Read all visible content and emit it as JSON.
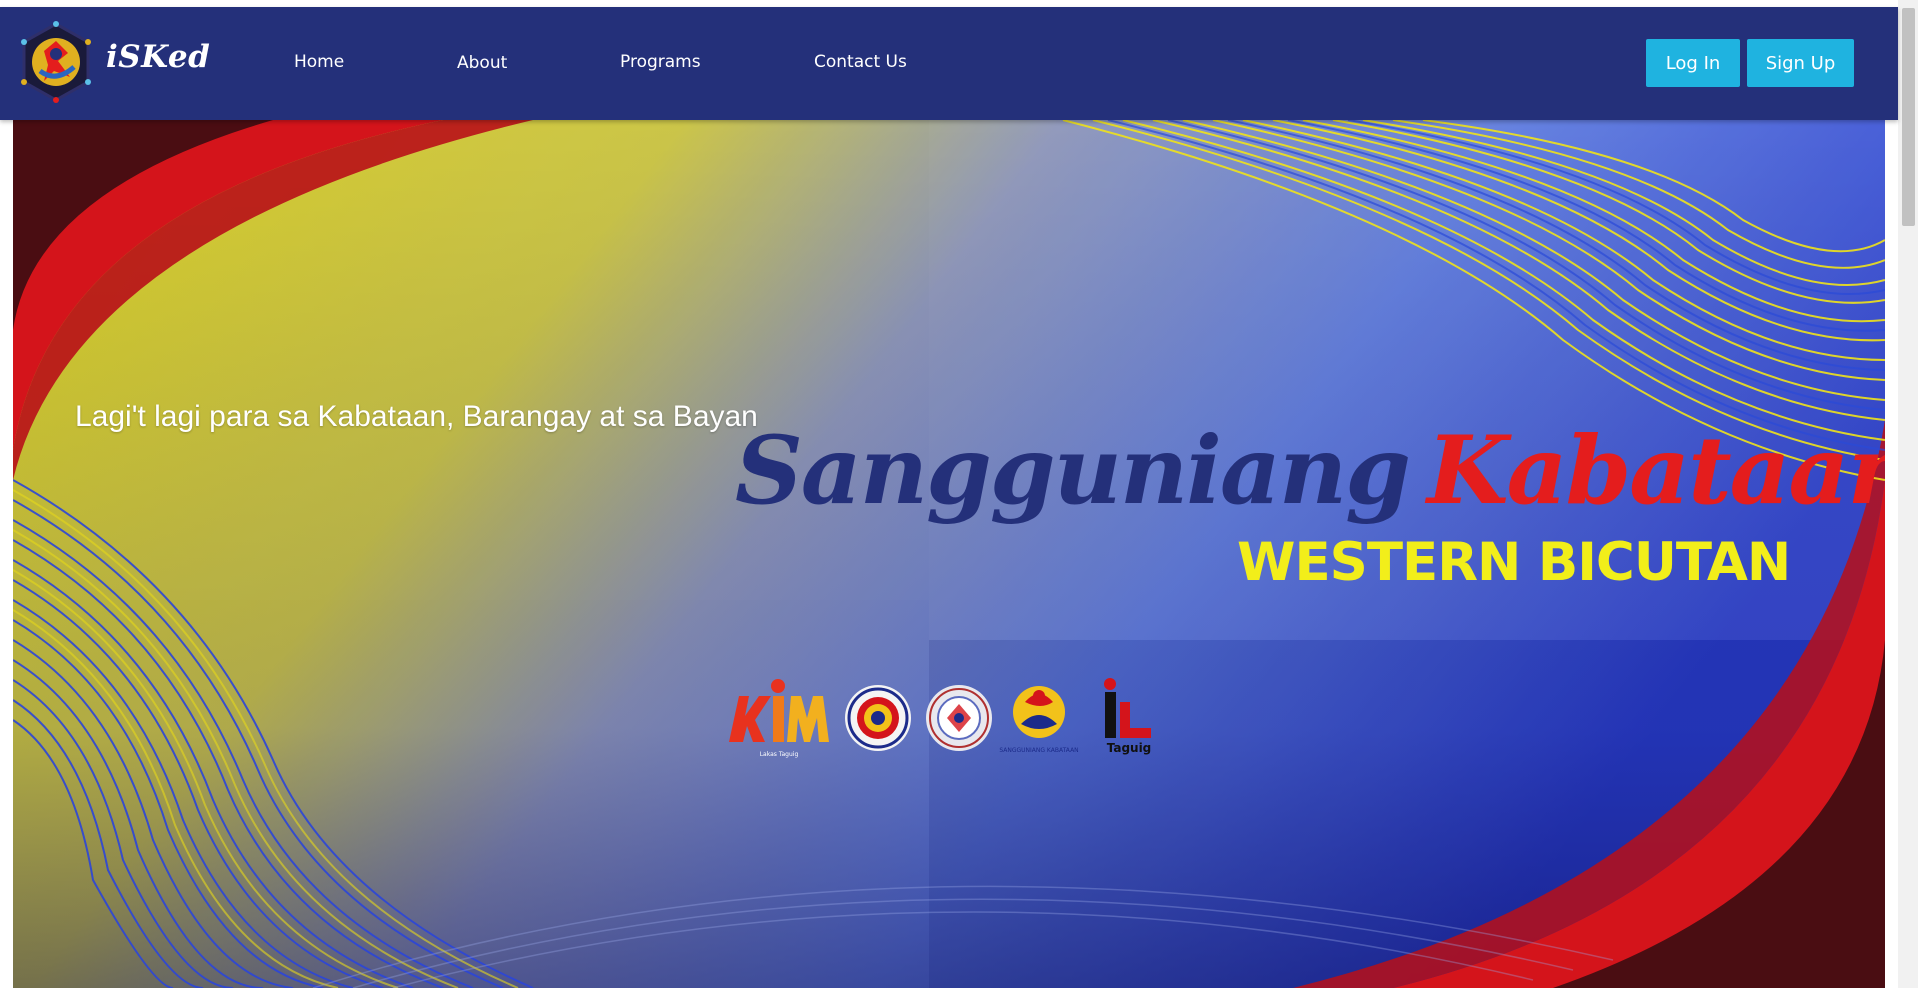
{
  "header": {
    "brand": "iSKed",
    "nav": [
      "Home",
      "About",
      "Programs",
      "Contact Us"
    ],
    "login_label": "Log In",
    "signup_label": "Sign Up"
  },
  "hero": {
    "tagline": "Lagi't lagi para sa Kabataan, Barangay at sa Bayan",
    "title_part1": "Sangguniang",
    "title_part2": "Kabataan",
    "subtitle": "WESTERN BICUTAN",
    "partner_logos": {
      "ttm_text": "Lakas Taguig",
      "taguig_text": "Taguig",
      "sk_text": "SANGGUNIANG KABATAAN"
    }
  },
  "colors": {
    "navbar": "#24307a",
    "button": "#1fb3e0",
    "title_blue": "#24307a",
    "title_red": "#e41d1d",
    "subtitle_yellow": "#f2ee1a"
  }
}
